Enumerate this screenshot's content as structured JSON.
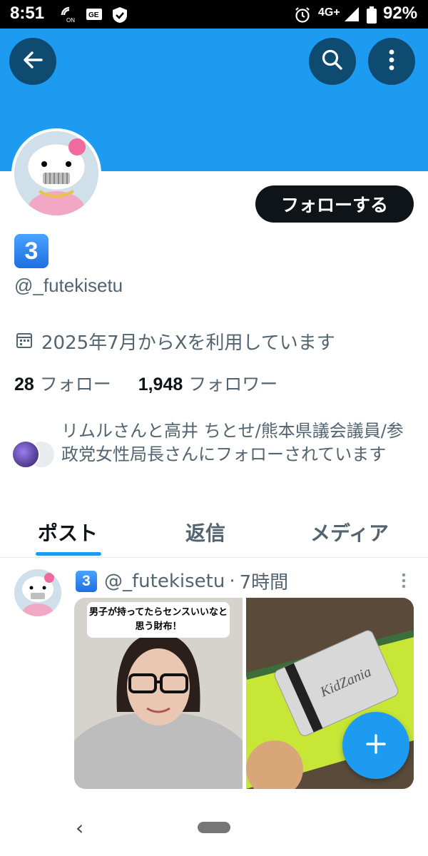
{
  "status_bar": {
    "time": "8:51",
    "network": "4G+",
    "battery": "92%",
    "icons": [
      "hotspot-on-icon",
      "ge-icon",
      "shield-check-icon",
      "alarm-icon",
      "signal-icon",
      "battery-icon"
    ]
  },
  "header": {
    "back_icon": "arrow-left-icon",
    "search_icon": "search-icon",
    "more_icon": "more-vertical-icon",
    "banner_color": "#1d9bf0"
  },
  "profile": {
    "display_name_emoji": "3",
    "handle": "@_futekisetu",
    "follow_button": "フォローする",
    "joined": "2025年7月からXを利用しています",
    "following_count": "28",
    "following_label": "フォロー",
    "followers_count": "1,948",
    "followers_label": "フォロワー",
    "followed_by": "リムルさんと高井 ちとせ/熊本県議会議員/参政党女性局長さんにフォローされています"
  },
  "tabs": [
    {
      "label": "ポスト",
      "active": true
    },
    {
      "label": "返信",
      "active": false
    },
    {
      "label": "メディア",
      "active": false
    }
  ],
  "post": {
    "name_emoji": "3",
    "handle": "@_futekisetu",
    "separator": "·",
    "time": "7時間",
    "image1_caption": "男子が持ってたらセンスいいなと思う財布！"
  },
  "fab_icon": "plus-icon",
  "nav": {
    "back": "‹"
  }
}
